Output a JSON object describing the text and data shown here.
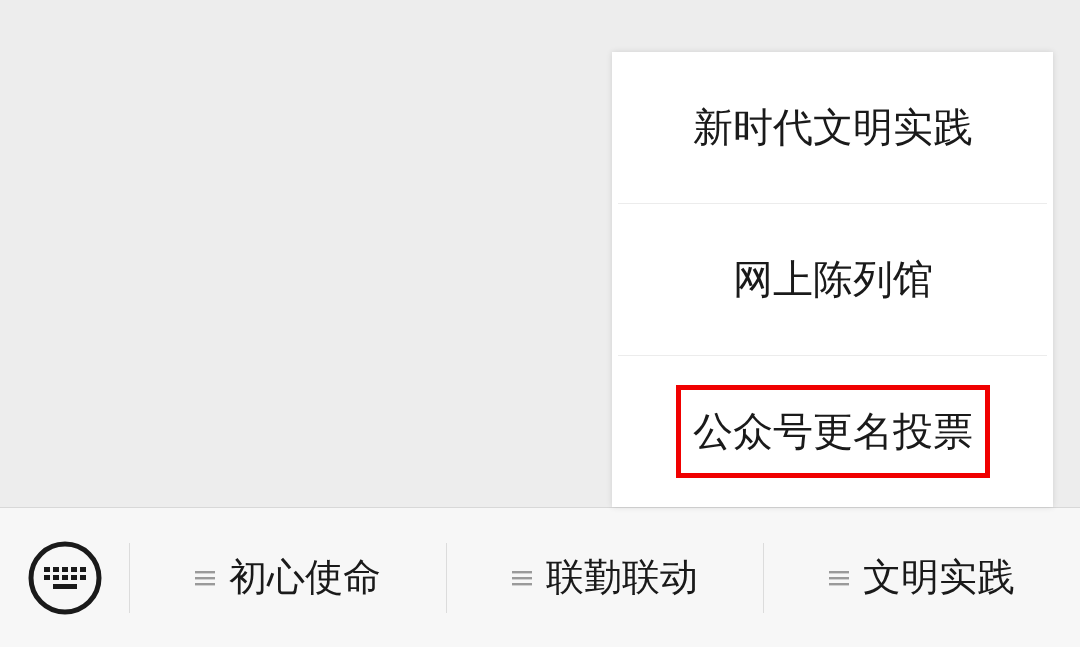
{
  "bottom_menu": {
    "items": [
      {
        "label": "初心使命"
      },
      {
        "label": "联勤联动"
      },
      {
        "label": "文明实践",
        "submenu": [
          {
            "label": "新时代文明实践",
            "highlighted": false
          },
          {
            "label": "网上陈列馆",
            "highlighted": false
          },
          {
            "label": "公众号更名投票",
            "highlighted": true
          }
        ]
      }
    ]
  }
}
